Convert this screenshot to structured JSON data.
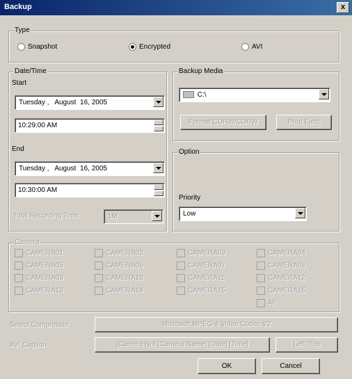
{
  "window": {
    "title": "Backup",
    "close": "x"
  },
  "type_group": {
    "legend": "Type",
    "options": [
      "Snapshot",
      "Encrypted",
      "AVI"
    ],
    "selected": "Encrypted"
  },
  "datetime": {
    "legend": "Date/Time",
    "start_label": "Start",
    "start_day": "Tuesday",
    "start_month": "August",
    "start_date": "16, 2005",
    "start_time": "10:29:00 AM",
    "end_label": "End",
    "end_day": "Tuesday",
    "end_month": "August",
    "end_date": "16, 2005",
    "end_time": "10:30:00 AM",
    "total_label": "Total Recording Time",
    "total_value": "1M"
  },
  "media": {
    "legend": "Backup Media",
    "drive": "C:\\",
    "format_label": "Format CDRW/CDRW",
    "eject_label": "Prod Eject"
  },
  "option": {
    "legend": "Option",
    "priority_label": "Priority",
    "priority_value": "Low"
  },
  "camera": {
    "legend": "Camera",
    "items": [
      "CAMERA01",
      "CAMERA02",
      "CAMERA03",
      "CAMERA04",
      "CAMERA05",
      "CAMERA06",
      "CAMERA07",
      "CAMERA08",
      "CAMERA09",
      "CAMERA10",
      "CAMERA11",
      "CAMERA12",
      "CAMERA13",
      "CAMERA14",
      "CAMERA15",
      "CAMERA16"
    ],
    "all_label": "All"
  },
  "compressor": {
    "label": "Select Compressor",
    "value": "Microsoft MPEG-4 Video Codec V2"
  },
  "caption": {
    "label": "AVI Caption",
    "value": "[Camera No] [Camera Name] [Date] [Time]",
    "position": "Left, Top"
  },
  "buttons": {
    "ok": "OK",
    "cancel": "Cancel"
  }
}
